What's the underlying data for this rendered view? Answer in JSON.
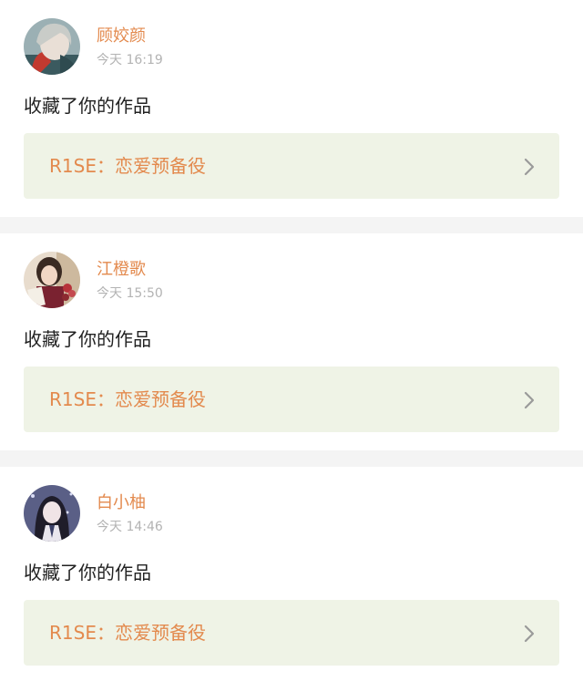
{
  "feed": [
    {
      "user": "顾姣颜",
      "time": "今天 16:19",
      "action": "收藏了你的作品",
      "work_title": "R1SE：恋爱预备役"
    },
    {
      "user": "江橙歌",
      "time": "今天 15:50",
      "action": "收藏了你的作品",
      "work_title": "R1SE：恋爱预备役"
    },
    {
      "user": "白小柚",
      "time": "今天 14:46",
      "action": "收藏了你的作品",
      "work_title": "R1SE：恋爱预备役"
    }
  ],
  "colors": {
    "accent": "#e38a4e",
    "timestamp": "#b3b3b3",
    "link_bg": "#eff3e6",
    "divider_bg": "#f4f4f4"
  },
  "icons": {
    "chevron": "chevron-right-icon"
  }
}
